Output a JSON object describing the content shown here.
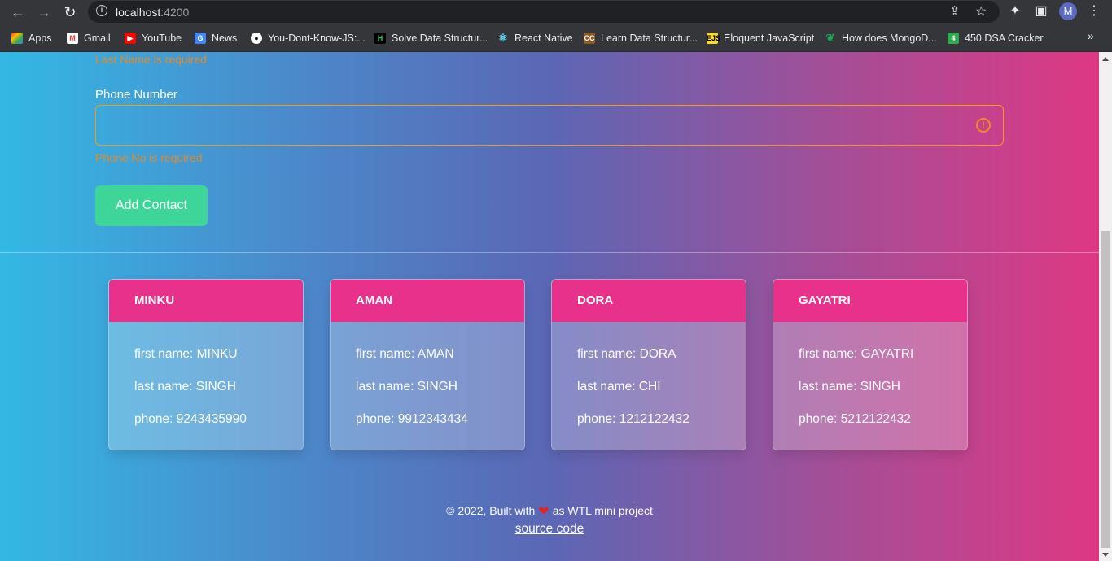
{
  "browser": {
    "url_host": "localhost",
    "url_port": ":4200",
    "profile_initial": "M",
    "bookmarks": [
      {
        "label": "Apps",
        "icon": "apps-grid-icon"
      },
      {
        "label": "Gmail",
        "icon": "gmail-icon"
      },
      {
        "label": "YouTube",
        "icon": "youtube-icon"
      },
      {
        "label": "News",
        "icon": "news-icon"
      },
      {
        "label": "You-Dont-Know-JS:...",
        "icon": "github-icon"
      },
      {
        "label": "Solve Data Structur...",
        "icon": "hackerrank-icon"
      },
      {
        "label": "React Native",
        "icon": "react-icon"
      },
      {
        "label": "Learn Data Structur...",
        "icon": "codechef-icon"
      },
      {
        "label": "Eloquent JavaScript",
        "icon": "ejs-icon"
      },
      {
        "label": "How does MongoD...",
        "icon": "mongodb-leaf-icon"
      },
      {
        "label": "450 DSA Cracker",
        "icon": "dsa-cracker-icon"
      }
    ]
  },
  "form": {
    "last_name_error": "Last Name is required",
    "phone_label": "Phone Number",
    "phone_value": "",
    "phone_error": "Phone No is required",
    "add_button": "Add Contact"
  },
  "contacts": [
    {
      "header": "MINKU",
      "first": "first name: MINKU",
      "last": "last name: SINGH",
      "phone": "phone: 9243435990"
    },
    {
      "header": "AMAN",
      "first": "first name: AMAN",
      "last": "last name: SINGH",
      "phone": "phone: 9912343434"
    },
    {
      "header": "DORA",
      "first": "first name: DORA",
      "last": "last name: CHI",
      "phone": "phone: 1212122432"
    },
    {
      "header": "GAYATRI",
      "first": "first name: GAYATRI",
      "last": "last name: SINGH",
      "phone": "phone: 5212122432"
    }
  ],
  "footer": {
    "text_before": "© 2022, Built with",
    "text_after": "as WTL mini project",
    "source_link": "source code"
  },
  "colors": {
    "gradient_start": "#33b8e4",
    "gradient_end": "#de3884",
    "card_header": "#e8318a",
    "add_button": "#3ed598",
    "error": "#e08a2e"
  }
}
